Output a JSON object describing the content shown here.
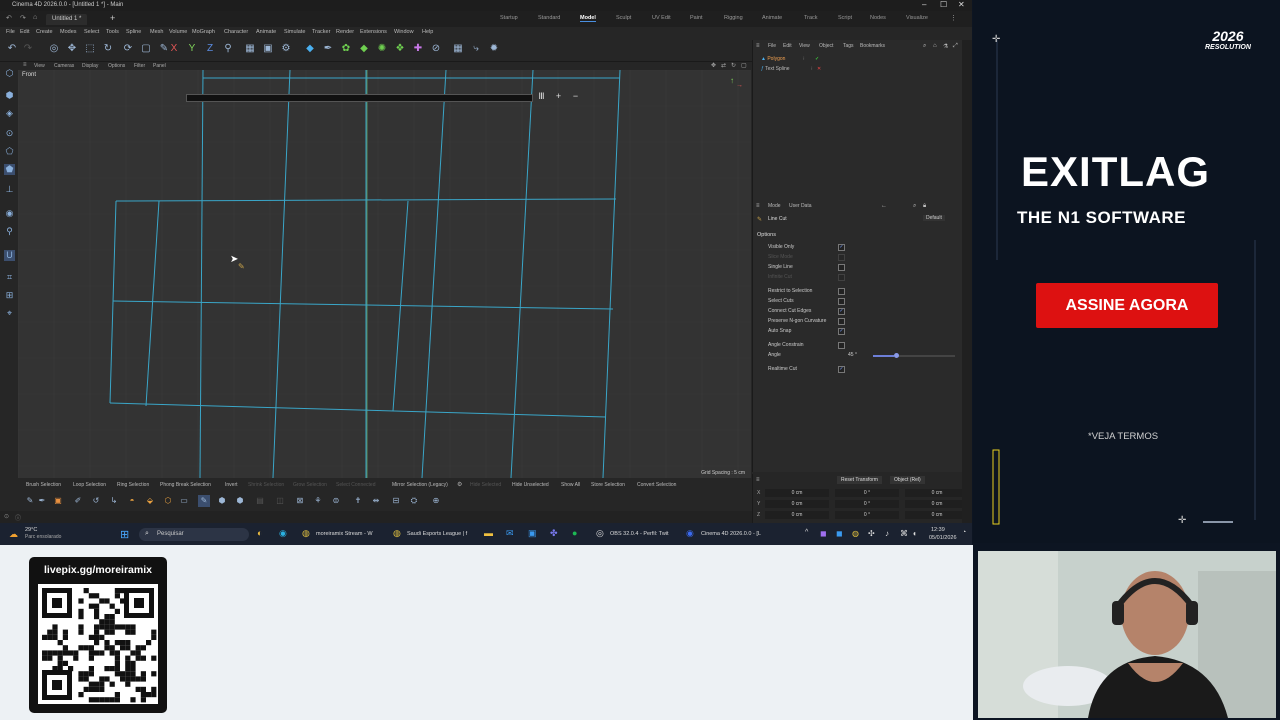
{
  "window": {
    "title": "Cinema 4D 2026.0.0 - [Untitled 1 *] - Main"
  },
  "tabs": {
    "document": "Untitled 1 *"
  },
  "layouts": [
    {
      "label": "Startup",
      "active": false
    },
    {
      "label": "Standard",
      "active": false
    },
    {
      "label": "Model",
      "active": true
    },
    {
      "label": "Sculpt",
      "active": false
    },
    {
      "label": "UV Edit",
      "active": false
    },
    {
      "label": "Paint",
      "active": false
    },
    {
      "label": "Rigging",
      "active": false
    },
    {
      "label": "Animate",
      "active": false
    },
    {
      "label": "Track",
      "active": false
    },
    {
      "label": "Script",
      "active": false
    },
    {
      "label": "Nodes",
      "active": false
    },
    {
      "label": "Visualize",
      "active": false
    }
  ],
  "menus": [
    "File",
    "Edit",
    "Create",
    "Modes",
    "Select",
    "Tools",
    "Spline",
    "Mesh",
    "Volume",
    "MoGraph",
    "Character",
    "Animate",
    "Simulate",
    "Tracker",
    "Render",
    "Extensions",
    "Window",
    "Help"
  ],
  "viewport": {
    "menus": [
      "View",
      "Cameras",
      "Display",
      "Options",
      "Filter",
      "Panel"
    ],
    "label": "Front",
    "grid_spacing": "Grid Spacing : 5 cm",
    "wire_color": "#3aa6c8"
  },
  "bottombar": [
    {
      "label": "Brush Selection",
      "dim": false
    },
    {
      "label": "Loop Selection",
      "dim": false
    },
    {
      "label": "Ring Selection",
      "dim": false
    },
    {
      "label": "Phong Break Selection",
      "dim": false
    },
    {
      "label": "Invert",
      "dim": false
    },
    {
      "label": "Shrink Selection",
      "dim": true
    },
    {
      "label": "Grow Selection",
      "dim": true
    },
    {
      "label": "Select Connected",
      "dim": true
    },
    {
      "label": "Mirror Selection (Legacy)",
      "dim": false
    },
    {
      "label": "Hide Selected",
      "dim": true
    },
    {
      "label": "Hide Unselected",
      "dim": false
    },
    {
      "label": "Show All",
      "dim": false
    },
    {
      "label": "Store Selection",
      "dim": false
    },
    {
      "label": "Convert Selection",
      "dim": false
    }
  ],
  "objects": {
    "menus": [
      "File",
      "Edit",
      "View",
      "Object",
      "Tags",
      "Bookmarks"
    ],
    "items": [
      "Polygon",
      "Text Spline"
    ]
  },
  "attributes": {
    "menus": [
      "Mode",
      "User Data"
    ],
    "tool": "Line Cut",
    "preset": "Default",
    "section": "Options",
    "options": [
      {
        "label": "Visible Only",
        "checked": true,
        "dim": false
      },
      {
        "label": "Slice Mode",
        "checked": false,
        "dim": true
      },
      {
        "label": "Single Line",
        "checked": false,
        "dim": false
      },
      {
        "label": "Infinite Cut",
        "checked": false,
        "dim": true
      },
      {
        "label": "Restrict to Selection",
        "checked": false,
        "dim": false
      },
      {
        "label": "Select Cuts",
        "checked": false,
        "dim": false
      },
      {
        "label": "Connect Cut Edges",
        "checked": true,
        "dim": false
      },
      {
        "label": "Preserve N-gon Curvature",
        "checked": false,
        "dim": false
      },
      {
        "label": "Auto Snap",
        "checked": true,
        "dim": false
      },
      {
        "label": "Angle Constrain",
        "checked": false,
        "dim": false
      },
      {
        "label": "Angle",
        "value": "45 °",
        "dim": false
      },
      {
        "label": "Realtime Cut",
        "checked": true,
        "dim": false
      }
    ],
    "angle_fraction": 0.25
  },
  "coords": {
    "buttons": [
      "Reset Transform",
      "Object (Rel)"
    ],
    "rows": [
      {
        "axis": "X",
        "a": "0 cm",
        "b": "0 °",
        "c": "0 cm"
      },
      {
        "axis": "Y",
        "a": "0 cm",
        "b": "0 °",
        "c": "0 cm"
      },
      {
        "axis": "Z",
        "a": "0 cm",
        "b": "0 °",
        "c": "0 cm"
      }
    ]
  },
  "taskbar": {
    "weather_temp": "29°C",
    "weather_desc": "Parc ensolarado",
    "search_placeholder": "Pesquisar",
    "apps": [
      "moreiramix Stream - W",
      "Saudi Esports League | f",
      "OBS 32.0.4 - Perfil: Twit",
      "Cinema 4D 2026.0.0 - [L"
    ],
    "time": "12:39",
    "date": "05/01/2026"
  },
  "ad": {
    "badge_top": "2026",
    "badge_bottom": "RESOLUTION",
    "brand": "EXITLAG",
    "tagline": "THE N1 SOFTWARE",
    "cta": "ASSINE AGORA",
    "terms": "*VEJA TERMOS",
    "cta_color": "#dd1111"
  },
  "livepix": {
    "url": "livepix.gg/moreiramix"
  }
}
